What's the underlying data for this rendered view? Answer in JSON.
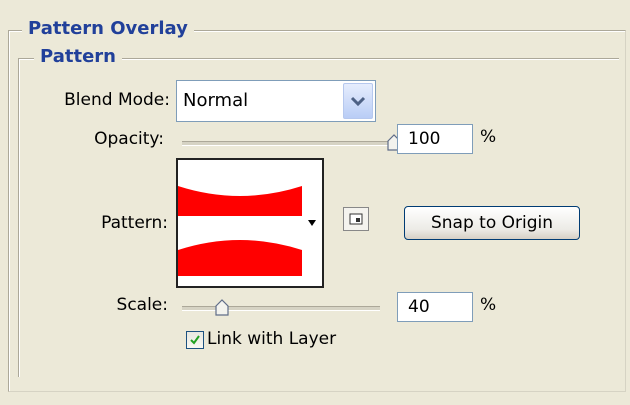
{
  "outer_group": {
    "title": "Pattern Overlay"
  },
  "inner_group": {
    "title": "Pattern"
  },
  "blend_mode": {
    "label": "Blend Mode:",
    "value": "Normal"
  },
  "opacity": {
    "label": "Opacity:",
    "value": "100",
    "unit": "%",
    "level": 1.0
  },
  "pattern": {
    "label": "Pattern:",
    "colors": {
      "stripe": "#ff0000",
      "background": "#ffffff"
    }
  },
  "snap_button": {
    "label": "Snap to Origin"
  },
  "scale": {
    "label": "Scale:",
    "value": "40",
    "unit": "%",
    "level": 0.2
  },
  "link_with_layer": {
    "label": "Link with Layer",
    "checked": true
  },
  "icons": [
    "chevron-down-icon",
    "slider-thumb-icon",
    "dropdown-arrow-icon",
    "new-preset-icon",
    "checkmark-icon"
  ]
}
